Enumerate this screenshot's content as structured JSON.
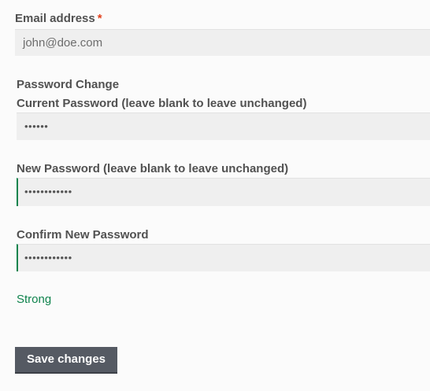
{
  "email": {
    "label": "Email address",
    "required_marker": "*",
    "value": "john@doe.com"
  },
  "password_change": {
    "heading": "Password Change",
    "current": {
      "label": "Current Password (leave blank to leave unchanged)",
      "masked_value": "••••••"
    },
    "new": {
      "label": "New Password (leave blank to leave unchanged)",
      "masked_value": "••••••••••••"
    },
    "confirm": {
      "label": "Confirm New Password",
      "masked_value": "••••••••••••"
    },
    "strength": {
      "text": "Strong",
      "color": "#0f834d"
    }
  },
  "actions": {
    "save_label": "Save changes"
  },
  "colors": {
    "required": "#e2401c",
    "valid_border": "#0f834d",
    "button_bg": "#555a63"
  }
}
